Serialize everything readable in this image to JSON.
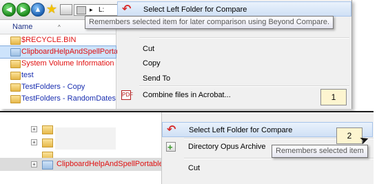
{
  "panel1": {
    "toolbar": {
      "drive_label": "L:",
      "drive_arrow": "▸"
    },
    "file_list": {
      "column_header": "Name",
      "items": [
        {
          "name": "$RECYCLE.BIN",
          "color": "red",
          "selected": false
        },
        {
          "name": "ClipboardHelpAndSpellPortable",
          "color": "red",
          "selected": true
        },
        {
          "name": "System Volume Information",
          "color": "red",
          "selected": false
        },
        {
          "name": "test",
          "color": "blue",
          "selected": false
        },
        {
          "name": "TestFolders - Copy",
          "color": "blue",
          "selected": false
        },
        {
          "name": "TestFolders - RandomDates",
          "color": "blue",
          "selected": false
        }
      ]
    },
    "context_menu": {
      "compare_item": "Select Left Folder for Compare",
      "cut": "Cut",
      "copy": "Copy",
      "send_to": "Send To",
      "combine": "Combine files in Acrobat..."
    },
    "tooltip": "Remembers selected item for later comparison using Beyond Compare.",
    "badge": "1"
  },
  "panel2": {
    "tree": {
      "items": [
        {
          "name": "",
          "selected": false
        },
        {
          "name": "",
          "selected": false
        },
        {
          "name": "",
          "selected": false
        },
        {
          "name": "ClipboardHelpAndSpellPortable",
          "selected": true
        }
      ]
    },
    "context_menu": {
      "compare_item": "Select Left Folder for Compare",
      "dopus": "Directory Opus Archive",
      "cut": "Cut"
    },
    "tooltip": "Remembers selected item",
    "badge": "2"
  },
  "colors": {
    "menu_bg": "#f0f0f0",
    "highlight": "#cfe0f5",
    "red_text": "#e01010",
    "blue_text": "#1a2fb0",
    "badge_bg": "#fdf5d0"
  }
}
